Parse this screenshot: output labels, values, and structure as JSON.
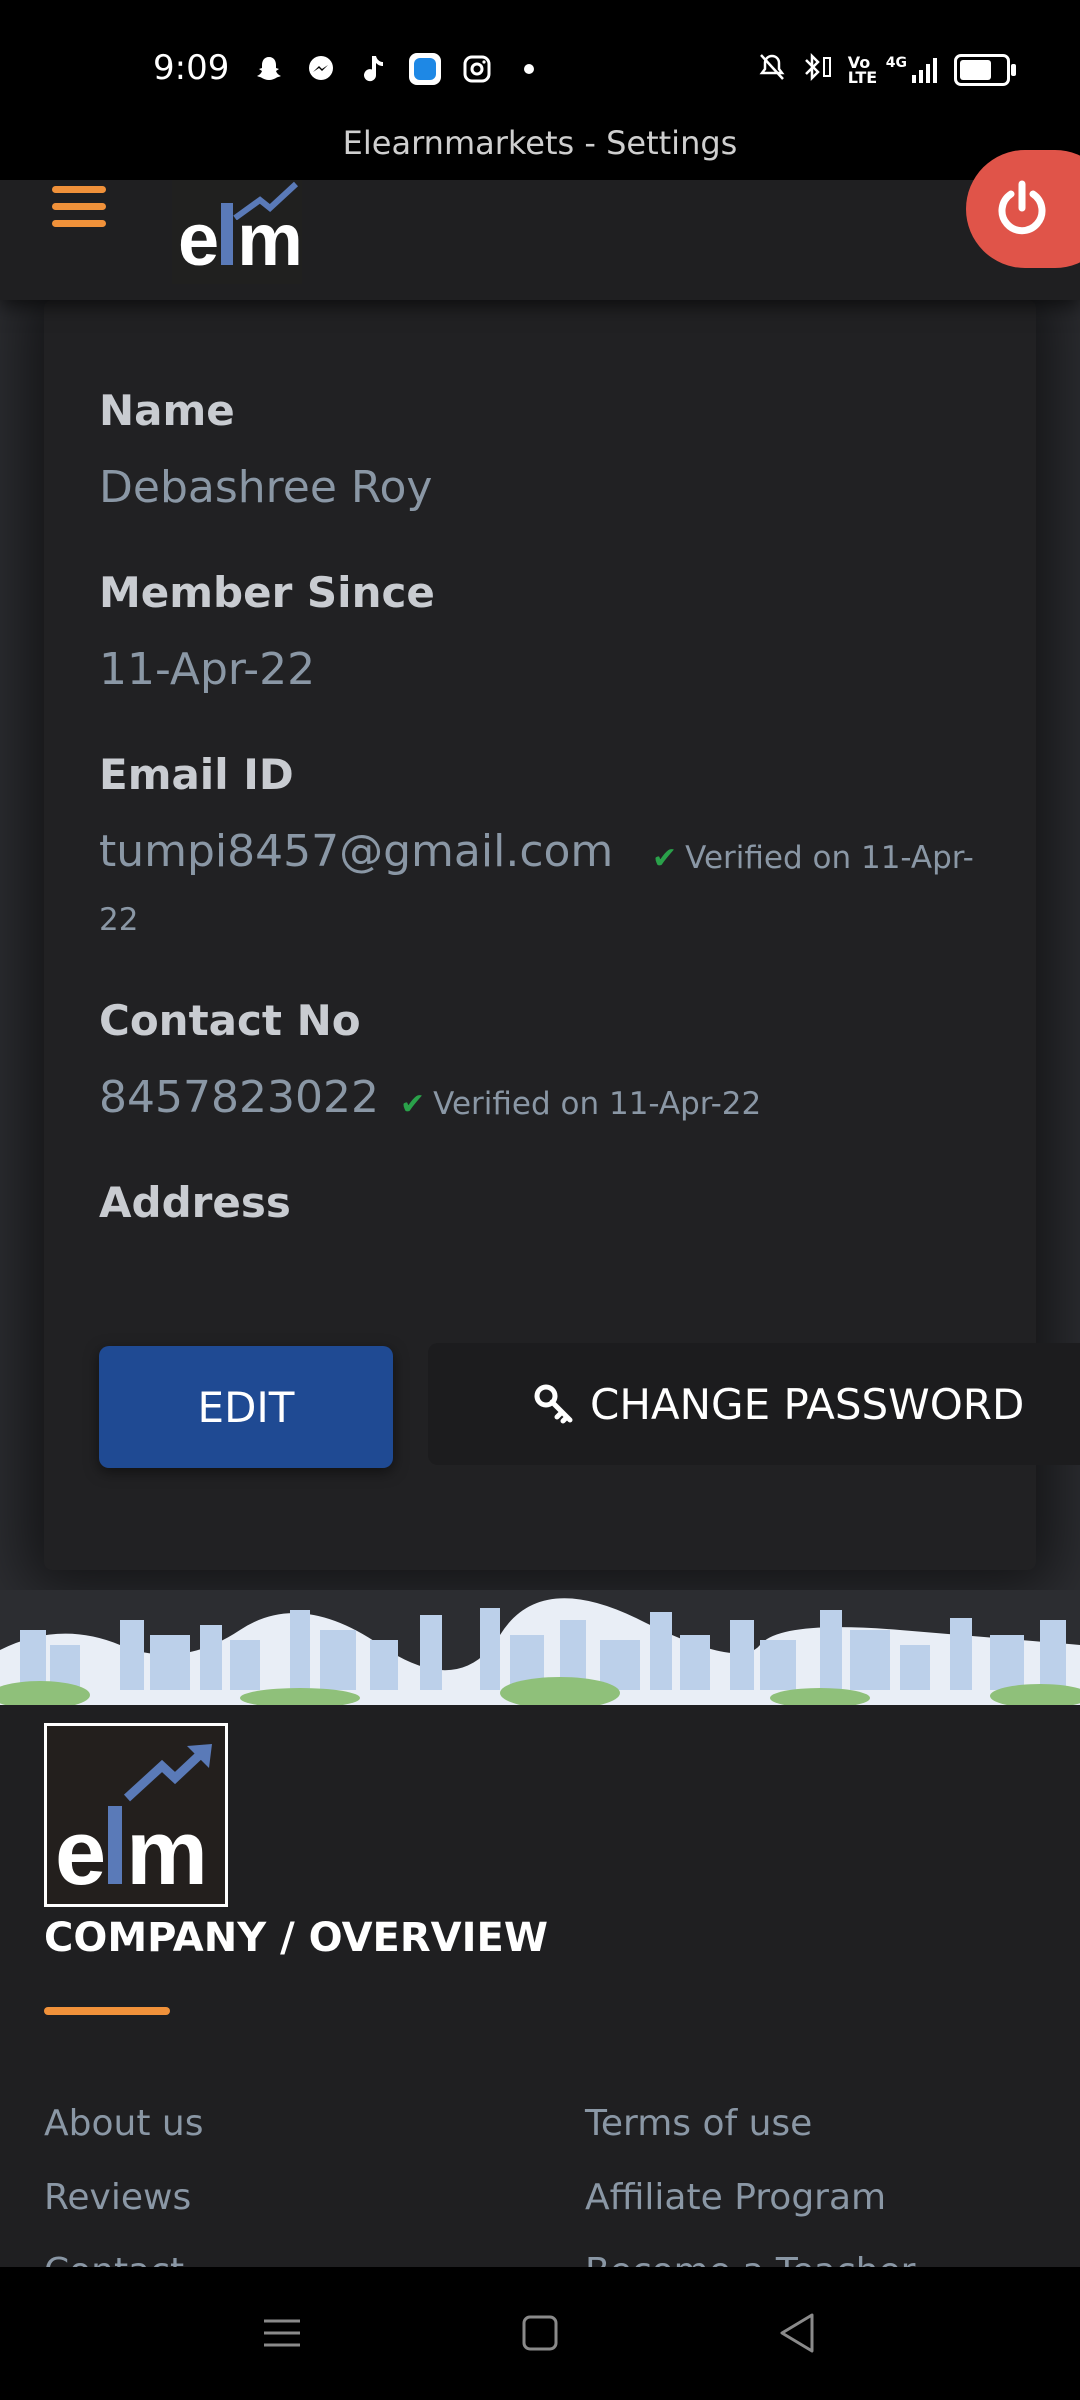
{
  "status_bar": {
    "time": "9:09",
    "left_icons": [
      "snapchat-icon",
      "messenger-icon",
      "music-icon",
      "app-icon",
      "instagram-icon",
      "dot-icon"
    ],
    "right_icons": [
      "mute-icon",
      "bluetooth-icon",
      "volte-icon",
      "4g-signal-icon",
      "battery-icon"
    ],
    "network": "4G",
    "volte": "Vo LTE"
  },
  "window": {
    "title": "Elearnmarkets - Settings"
  },
  "header": {
    "logo_text_left": "e",
    "logo_text_right": "m",
    "menu_icon": "hamburger-icon",
    "power_icon": "power-icon"
  },
  "profile": {
    "name_label": "Name",
    "name_value": "Debashree Roy",
    "member_since_label": "Member Since",
    "member_since_value": "11-Apr-22",
    "email_label": "Email ID",
    "email_value": "tumpi8457@gmail.com",
    "email_verified_line1": "Verified on 11-Apr-",
    "email_verified_line2": "22",
    "contact_label": "Contact No",
    "contact_value": "8457823022",
    "contact_verified": "Verified on 11-Apr-22",
    "address_label": "Address",
    "address_value": ""
  },
  "buttons": {
    "edit": "EDIT",
    "change_password": "CHANGE PASSWORD"
  },
  "footer": {
    "heading": "COMPANY / OVERVIEW",
    "links_left": [
      "About us",
      "Reviews",
      "Contact"
    ],
    "links_right": [
      "Terms of use",
      "Affiliate Program",
      "Become a Teacher"
    ]
  },
  "colors": {
    "accent_orange": "#f0913a",
    "edit_blue": "#1f4a93",
    "power_red": "#e05449",
    "verified_green": "#2aa14a"
  }
}
